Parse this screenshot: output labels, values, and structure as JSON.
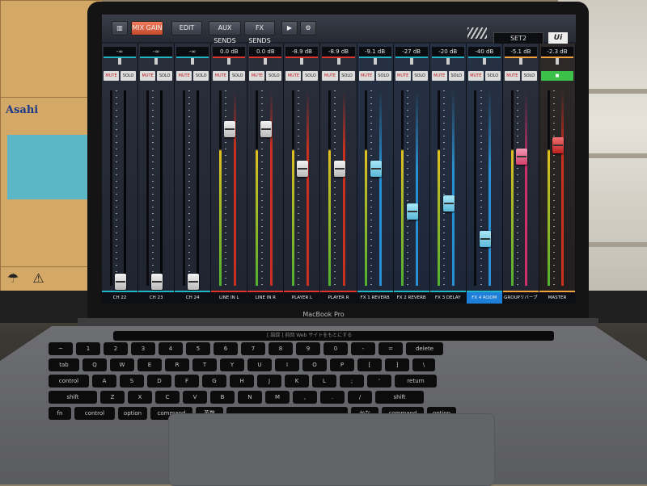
{
  "scene": {
    "box_brand": "Asahi",
    "laptop_brand": "MacBook Pro",
    "touchbar_text": "[ 語録 ] 前回 Web サイトをもとにする"
  },
  "toolbar": {
    "mix_gain": "MIX GAIN",
    "edit": "EDIT",
    "aux_sends": "AUX SENDS",
    "fx_sends": "FX SENDS",
    "preset": "SET2",
    "logo": "Ui",
    "play_icon": "play-icon",
    "settings_icon": "gear-icon"
  },
  "channels": [
    {
      "name": "CH 22",
      "db": "-∞",
      "mute": "MUTE",
      "solo": "SOLO",
      "level": 0.02,
      "color": "cyan",
      "fader": "white"
    },
    {
      "name": "CH 23",
      "db": "-∞",
      "mute": "MUTE",
      "solo": "SOLO",
      "level": 0.02,
      "color": "cyan",
      "fader": "white"
    },
    {
      "name": "CH 24",
      "db": "-∞",
      "mute": "MUTE",
      "solo": "SOLO",
      "level": 0.02,
      "color": "cyan",
      "fader": "white"
    },
    {
      "name": "LINE IN L",
      "db": "0.0 dB",
      "mute": "MUTE",
      "solo": "SOLO",
      "level": 0.8,
      "color": "red",
      "fader": "white"
    },
    {
      "name": "LINE IN R",
      "db": "0.0 dB",
      "mute": "MUTE",
      "solo": "SOLO",
      "level": 0.8,
      "color": "red",
      "fader": "white"
    },
    {
      "name": "PLAYER L",
      "db": "-8.9 dB",
      "mute": "MUTE",
      "solo": "SOLO",
      "level": 0.6,
      "color": "red",
      "fader": "white"
    },
    {
      "name": "PLAYER R",
      "db": "-8.9 dB",
      "mute": "MUTE",
      "solo": "SOLO",
      "level": 0.6,
      "color": "red",
      "fader": "white"
    },
    {
      "name": "FX 1 REVERB",
      "db": "-9.1 dB",
      "mute": "MUTE",
      "solo": "SOLO",
      "level": 0.6,
      "color": "cyan",
      "fader": "cyan"
    },
    {
      "name": "FX 2 REVERB",
      "db": "-27 dB",
      "mute": "MUTE",
      "solo": "SOLO",
      "level": 0.38,
      "color": "cyan",
      "fader": "cyan"
    },
    {
      "name": "FX 3 DELAY",
      "db": "-20 dB",
      "mute": "MUTE",
      "solo": "SOLO",
      "level": 0.42,
      "color": "cyan",
      "fader": "cyan"
    },
    {
      "name": "FX 4 ROOM",
      "db": "-40 dB",
      "mute": "MUTE",
      "solo": "SOLO",
      "level": 0.24,
      "color": "cyan",
      "fader": "cyan"
    },
    {
      "name": "GROUPリバーブ",
      "db": "-5.1 dB",
      "mute": "MUTE",
      "solo": "SOLO",
      "level": 0.66,
      "color": "orange",
      "fader": "pink"
    },
    {
      "name": "MASTER",
      "db": "-2.3 dB",
      "mute": "",
      "solo": "",
      "level": 0.72,
      "color": "orange",
      "fader": "red"
    }
  ],
  "keyboard": {
    "row1": [
      "~",
      "1",
      "2",
      "3",
      "4",
      "5",
      "6",
      "7",
      "8",
      "9",
      "0",
      "-",
      "=",
      "delete"
    ],
    "row2": [
      "tab",
      "Q",
      "W",
      "E",
      "R",
      "T",
      "Y",
      "U",
      "I",
      "O",
      "P",
      "[",
      "]",
      "\\"
    ],
    "row3": [
      "control",
      "A",
      "S",
      "D",
      "F",
      "G",
      "H",
      "J",
      "K",
      "L",
      ";",
      "'",
      "return"
    ],
    "row4": [
      "shift",
      "Z",
      "X",
      "C",
      "V",
      "B",
      "N",
      "M",
      ",",
      ".",
      "/",
      "shift"
    ],
    "row5": [
      "fn",
      "control",
      "option",
      "command",
      "英数",
      "",
      "かな",
      "command",
      "option"
    ]
  }
}
